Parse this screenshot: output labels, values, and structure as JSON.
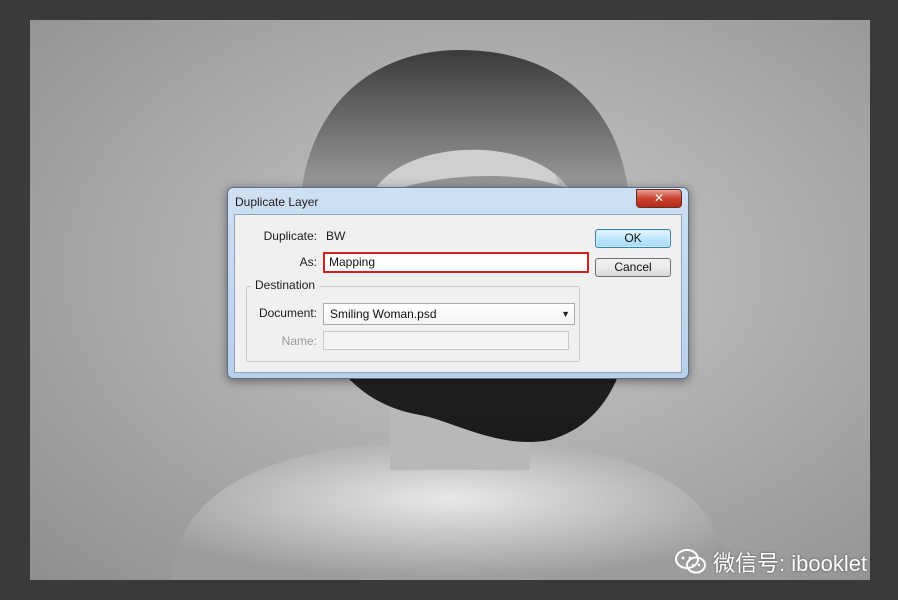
{
  "dialog": {
    "title": "Duplicate Layer",
    "close_glyph": "✕",
    "duplicate_label": "Duplicate:",
    "duplicate_value": "BW",
    "as_label": "As:",
    "as_value": "Mapping",
    "destination_label": "Destination",
    "document_label": "Document:",
    "document_value": "Smiling Woman.psd",
    "name_label": "Name:",
    "name_value": "",
    "ok_label": "OK",
    "cancel_label": "Cancel"
  },
  "watermark": {
    "text": "微信号: ibooklet",
    "icon": "wechat-icon"
  },
  "colors": {
    "highlight_border": "#d21f1f",
    "window_frame": "#b9d0ea",
    "close_button": "#c8412d"
  }
}
